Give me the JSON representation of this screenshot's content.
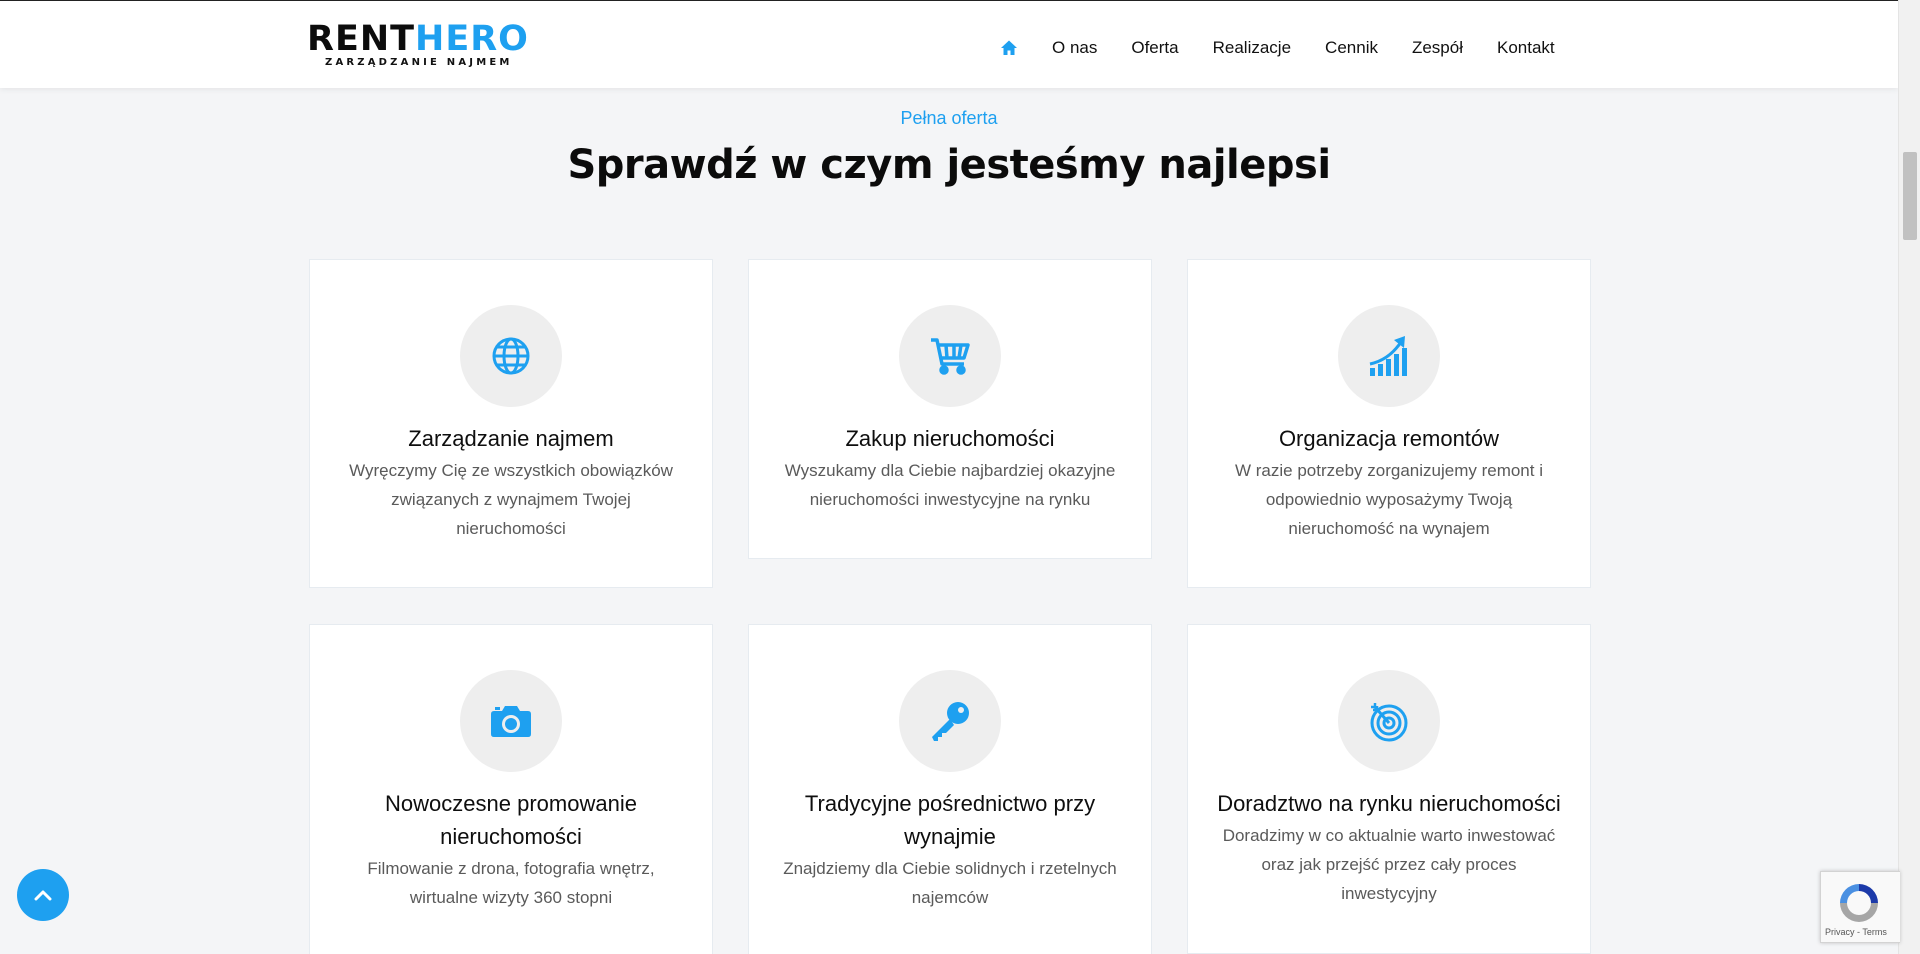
{
  "header": {
    "logo": {
      "main_part1": "RENT",
      "main_part2": "HERO",
      "subtitle": "ZARZĄDZANIE NAJMEM"
    },
    "nav": {
      "home_icon": "home-icon",
      "items": [
        "O nas",
        "Oferta",
        "Realizacje",
        "Cennik",
        "Zespół",
        "Kontakt"
      ]
    }
  },
  "section": {
    "eyebrow": "Pełna oferta",
    "title": "Sprawdź w czym jesteśmy najlepsi"
  },
  "cards": [
    {
      "icon": "globe-icon",
      "title": "Zarządzanie najmem",
      "desc": "Wyręczymy Cię ze wszystkich obowiązków związanych z wynajmem Twojej nieruchomości"
    },
    {
      "icon": "cart-icon",
      "title": "Zakup nieruchomości",
      "desc": "Wyszukamy dla Ciebie najbardziej okazyjne nieruchomości inwestycyjne na rynku"
    },
    {
      "icon": "chart-up-icon",
      "title": "Organizacja remontów",
      "desc": "W razie potrzeby zorganizujemy remont i odpowiednio wyposażymy Twoją nieruchomość na wynajem"
    },
    {
      "icon": "camera-icon",
      "title": "Nowoczesne promowanie nieruchomości",
      "desc": "Filmowanie z drona, fotografia wnętrz, wirtualne wizyty 360 stopni"
    },
    {
      "icon": "key-icon",
      "title": "Tradycyjne pośrednictwo przy wynajmie",
      "desc": "Znajdziemy dla Ciebie solidnych i rzetelnych najemców"
    },
    {
      "icon": "target-icon",
      "title": "Doradztwo na rynku nieruchomości",
      "desc": "Doradzimy w co aktualnie warto inwestować oraz jak przejść przez cały proces inwestycyjny"
    }
  ],
  "recaptcha": {
    "terms": "Privacy - Terms"
  },
  "colors": {
    "accent": "#1ea0f0",
    "background": "#f4f5f7",
    "card": "#ffffff"
  }
}
